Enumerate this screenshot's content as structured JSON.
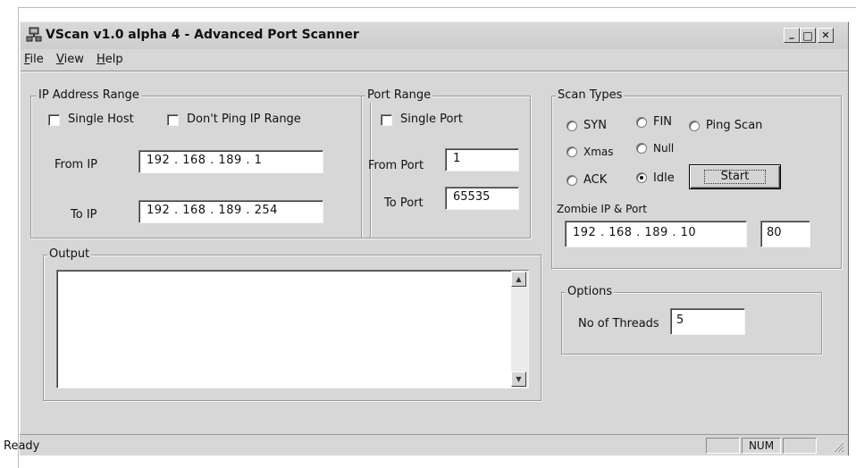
{
  "window": {
    "title": "VScan v1.0 alpha 4 - Advanced Port Scanner",
    "min_glyph": "_",
    "max_glyph": "□",
    "close_glyph": "✕"
  },
  "menu": [
    {
      "mnemonic": "F",
      "rest": "ile"
    },
    {
      "mnemonic": "V",
      "rest": "iew"
    },
    {
      "mnemonic": "H",
      "rest": "elp"
    }
  ],
  "ip_range": {
    "group_label": "IP Address Range",
    "single_host_label": "Single Host",
    "dont_ping_label": "Don't Ping IP Range",
    "from_label": "From IP",
    "from_value": "192 . 168 . 189 .  1",
    "to_label": "To IP",
    "to_value": "192 . 168 . 189 . 254"
  },
  "port_range": {
    "group_label": "Port Range",
    "single_port_label": "Single Port",
    "from_label": "From Port",
    "from_value": "1",
    "to_label": "To Port",
    "to_value": "65535"
  },
  "scan_types": {
    "group_label": "Scan Types",
    "syn": "SYN",
    "fin": "FIN",
    "ping": "Ping Scan",
    "xmas": "Xmas",
    "null": "Null",
    "ack": "ACK",
    "idle": "Idle",
    "selected": "Idle",
    "start_label": "Start",
    "zombie_label": "Zombie IP & Port",
    "zombie_ip": "192 . 168 . 189 . 10",
    "zombie_port": "80"
  },
  "output": {
    "group_label": "Output",
    "scroll_up_glyph": "▲",
    "scroll_down_glyph": "▼"
  },
  "options": {
    "group_label": "Options",
    "threads_label": "No of Threads",
    "threads_value": "5"
  },
  "status": {
    "text": "Ready",
    "num_indicator": "NUM"
  }
}
